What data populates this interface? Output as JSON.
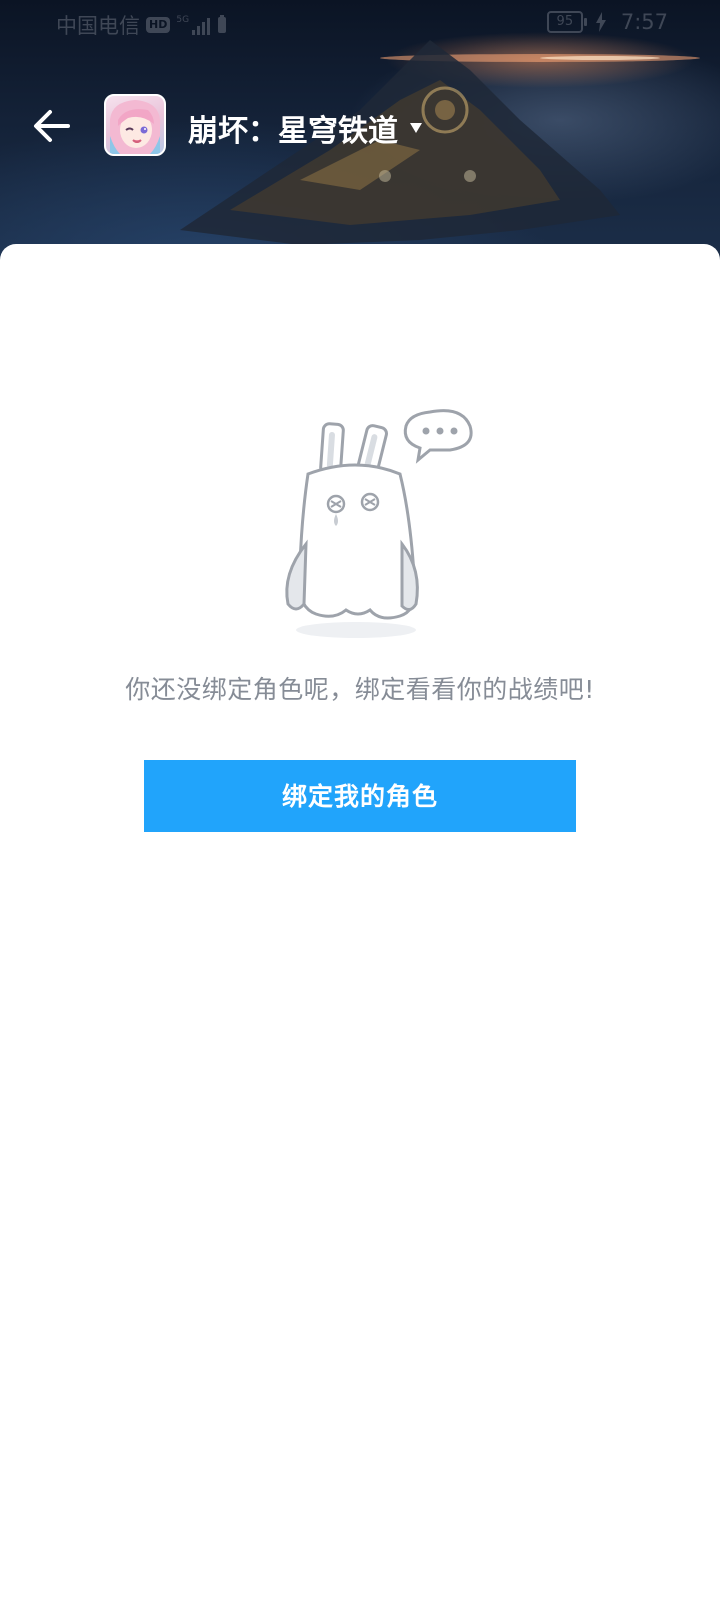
{
  "status_bar": {
    "carrier": "中国电信",
    "hd_badge": "HD",
    "network": "5G",
    "battery_level": "95",
    "time": "7:57"
  },
  "header": {
    "game_title": "崩坏：星穹铁道",
    "back_icon": "arrow-left-icon",
    "dropdown_icon": "triangle-down-icon"
  },
  "empty_state": {
    "message": "你还没绑定角色呢，绑定看看你的战绩吧!",
    "button_label": "绑定我的角色"
  },
  "colors": {
    "accent": "#21a4fb",
    "message_text": "#868c96",
    "header_dark": "#142238"
  }
}
